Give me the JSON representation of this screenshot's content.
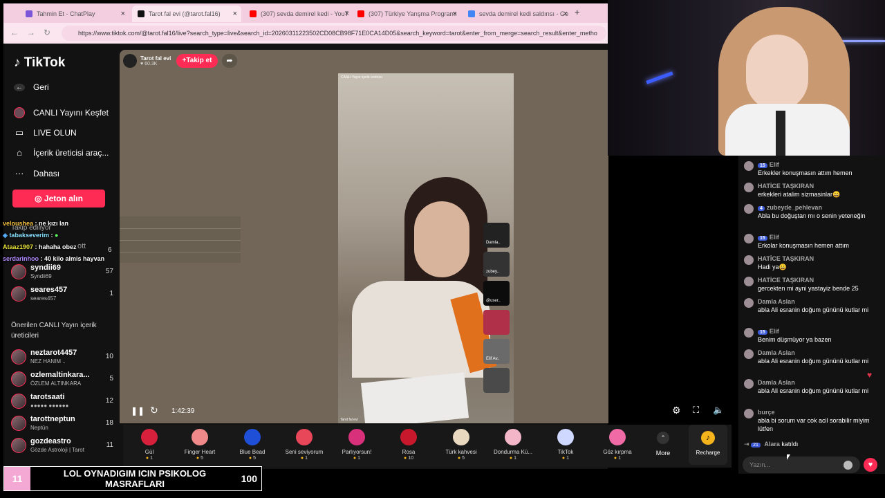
{
  "browser": {
    "tabs": [
      {
        "title": "Tahmin Et - ChatPlay",
        "fav_color": "#7b56d9"
      },
      {
        "title": "Tarot fal evi (@tarot.fal16)",
        "fav_color": "#111111"
      },
      {
        "title": "(307) sevda demirel kedi - YouT",
        "fav_color": "#ff0000"
      },
      {
        "title": "(307) Türkiye Yarışma Programı",
        "fav_color": "#ff0000"
      },
      {
        "title": "sevda demirel kedi saldırısı - Go",
        "fav_color": "#4285f4"
      }
    ],
    "url": "https://www.tiktok.com/@tarot.fal16/live?search_type=live&search_id=20260311223502CD08CB98F71E0CA14D05&search_keyword=tarot&enter_from_merge=search_result&enter_metho"
  },
  "sidebar": {
    "logo": "TikTok",
    "items": [
      {
        "icon": "back-arrow-icon",
        "label": "Geri"
      },
      {
        "icon": "live-avatar-icon",
        "label": "CANLI Yayını Keşfet"
      },
      {
        "icon": "camera-icon",
        "label": "LIVE OLUN"
      },
      {
        "icon": "creator-tools-icon",
        "label": "İçerik üreticisi araç..."
      },
      {
        "icon": "more-dots-icon",
        "label": "Dahası"
      }
    ],
    "jeton_button": "Jeton alın",
    "following_accounts": [
      {
        "name": "syndii69",
        "sub": "Syndii69",
        "count": "57"
      },
      {
        "name": "seares457",
        "sub": "seares457",
        "count": "1"
      }
    ],
    "hidden_count": "6",
    "recommended_title": "Önerilen CANLI Yayın içerik üreticileri",
    "recommended": [
      {
        "name": "neztarot4457",
        "sub": "NEZ HANIM ..",
        "count": "10"
      },
      {
        "name": "ozlemaltinkara...",
        "sub": "ÖZLEM ALTINKARA",
        "count": "5"
      },
      {
        "name": "tarotsaati",
        "sub": "●●●●● ●●●●●●",
        "count": "12"
      },
      {
        "name": "tarottneptun",
        "sub": "Neptün",
        "count": "18"
      },
      {
        "name": "gozdeastro",
        "sub": "Gözde Astroloji | Tarot",
        "count": "11"
      }
    ]
  },
  "overlay_chat": [
    {
      "user": "veloushea",
      "text": ": ne kızı lan",
      "color": "#f5c242"
    },
    {
      "user": "tabakseverim",
      "text": ":",
      "color": "#8be3ff"
    },
    {
      "user": "Ataaz1907",
      "text": ": hahaha obez",
      "color": "#e6e13c"
    },
    {
      "user": "serdarinhoo",
      "text": ": 40 kilo almis hayvan",
      "color": "#b48cff"
    }
  ],
  "overlay_ghost": [
    "Takip ediliyor",
    "ott"
  ],
  "stream": {
    "host_name": "Tarot fal evi",
    "host_likes": "60.3K",
    "follow_label": "+Takip et",
    "video_caption_top": "CANLI Yayın içerik üreticisi",
    "video_caption_bottom": "Tarot fal evi",
    "time": "1:42:39",
    "guests": [
      "Damla..",
      "zubey..",
      "@user..",
      "",
      "Elif Av..",
      ""
    ]
  },
  "gifts": [
    {
      "name": "Gül",
      "price": "1",
      "color": "#d6203c"
    },
    {
      "name": "Finger Heart",
      "price": "5",
      "color": "#f08a8a"
    },
    {
      "name": "Blue Bead",
      "price": "5",
      "color": "#1e4fd6"
    },
    {
      "name": "Seni seviyorum",
      "price": "1",
      "color": "#e8475a"
    },
    {
      "name": "Parlıyorsun!",
      "price": "1",
      "color": "#d8307a"
    },
    {
      "name": "Rosa",
      "price": "10",
      "color": "#c8182c"
    },
    {
      "name": "Türk kahvesi",
      "price": "5",
      "color": "#e8d8c0"
    },
    {
      "name": "Dondurma Kü...",
      "price": "1",
      "color": "#f2b6c8"
    },
    {
      "name": "TikTok",
      "price": "1",
      "color": "#cfd8ff"
    },
    {
      "name": "Göz kırpma",
      "price": "1",
      "color": "#f06aa6"
    }
  ],
  "more_label": "More",
  "recharge_label": "Recharge",
  "chat": [
    {
      "user": "Elif",
      "badge": "15",
      "text": "Erkekler konuşmasın attım hemen"
    },
    {
      "user": "HATİCE TAŞKIRAN",
      "badge": "",
      "text": "erkekleri atalim sizmasinlar😀"
    },
    {
      "user": "zubeyde_pehlevan",
      "badge": "4",
      "text": "Abla bu doğuştan mı o senin yeteneğin"
    },
    {
      "user": "Elif",
      "badge": "15",
      "text": "Erkolar konuşmasın hemen attım"
    },
    {
      "user": "HATİCE TAŞKIRAN",
      "badge": "",
      "text": "Hadi ya😀"
    },
    {
      "user": "HATİCE TAŞKIRAN",
      "badge": "",
      "text": "gercekten mi ayni yastayiz bende 25"
    },
    {
      "user": "Damla Aslan",
      "badge": "",
      "text": "abla Ali esranin doğum gününü kutlar mi"
    },
    {
      "user": "Elif",
      "badge": "15",
      "text": "Benim düşmüyor ya bazen"
    },
    {
      "user": "Damla Aslan",
      "badge": "",
      "text": "abla Ali esranin doğum gününü kutlar mi"
    },
    {
      "user": "Damla Aslan",
      "badge": "",
      "text": "abla Ali esranin doğum gününü kutlar mi"
    },
    {
      "user": "burçe",
      "badge": "",
      "text": "abla bi sorum var cok acil sorabilir miyim lütfen"
    }
  ],
  "join_notice": {
    "badge": "21",
    "user": "Alara",
    "text": "katıldı"
  },
  "chat_placeholder": "Yazın...",
  "goal": {
    "level": "11",
    "text": "LOL OYNADIGIM ICIN PSIKOLOG MASRAFLARI",
    "value": "100"
  }
}
